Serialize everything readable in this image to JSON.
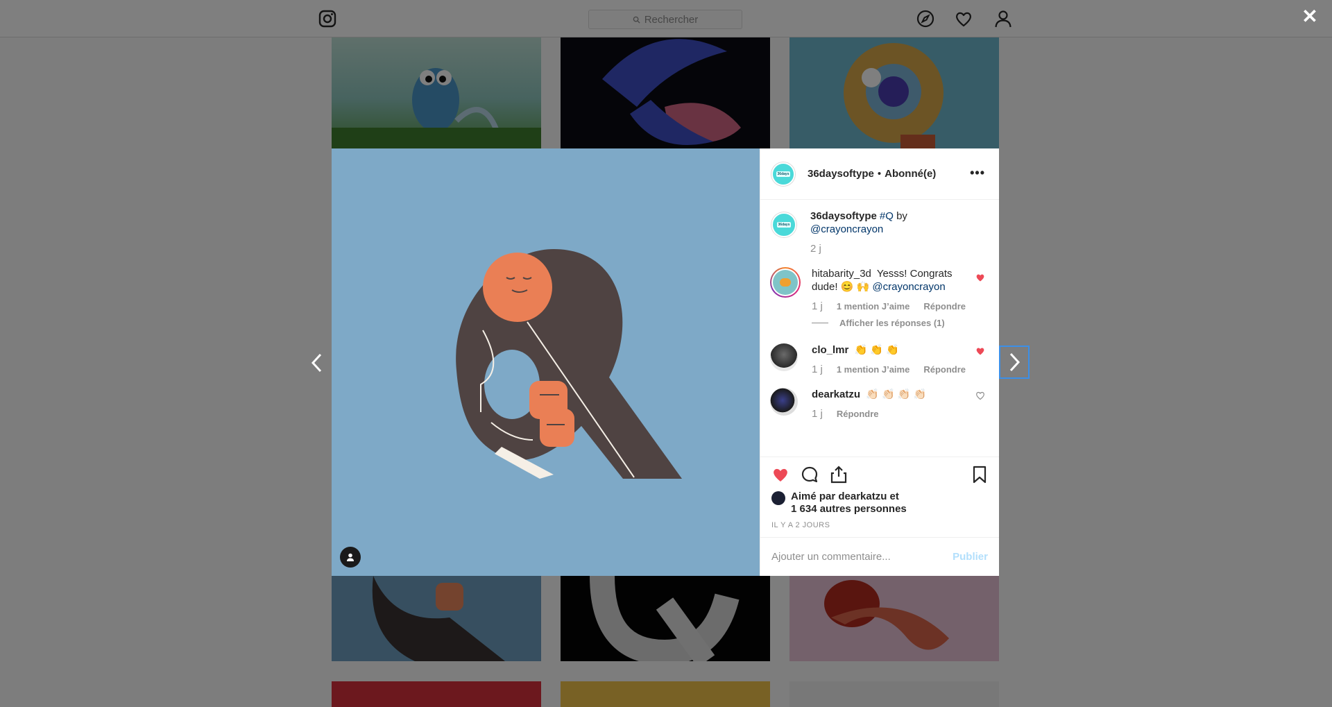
{
  "search": {
    "placeholder": "Rechercher"
  },
  "post": {
    "header": {
      "username": "36daysoftype",
      "separator": "•",
      "follow_status": "Abonné(e)",
      "more": "•••"
    },
    "avatar_badge": "36days",
    "caption": {
      "username": "36daysoftype",
      "hashtag": "#Q",
      "by": "by",
      "mention": "@crayoncrayon",
      "time": "2 j"
    },
    "comments": [
      {
        "username": "hitabarity_3d",
        "text": "Yesss! Congrats dude! 😊 🙌",
        "mention": "@crayoncrayon",
        "time": "1 j",
        "likes": "1 mention J’aime",
        "reply": "Répondre",
        "liked": true
      },
      {
        "username": "clo_lmr",
        "text": "👏 👏 👏",
        "time": "1 j",
        "likes": "1 mention J’aime",
        "reply": "Répondre",
        "liked": true
      },
      {
        "username": "dearkatzu",
        "text": "👏🏻 👏🏻 👏🏻 👏🏻",
        "time": "1 j",
        "reply": "Répondre",
        "liked": false
      }
    ],
    "view_replies": "Afficher les réponses (1)",
    "liked_by": {
      "line1": "Aimé par dearkatzu et",
      "line2": "1 634 autres personnes"
    },
    "posted": "IL Y A 2 JOURS",
    "comment_input": {
      "placeholder": "Ajouter un commentaire...",
      "value": ""
    },
    "publish": "Publier"
  },
  "colors": {
    "like_red": "#ed4956",
    "link_blue": "#003569",
    "publish_disabled": "#b2dffc",
    "focus_blue": "#3b8fe8"
  },
  "icons": [
    "instagram-icon",
    "search-icon",
    "explore-icon",
    "heart-icon",
    "profile-icon",
    "close-icon",
    "chevron-left-icon",
    "chevron-right-icon",
    "more-icon",
    "comment-icon",
    "share-icon",
    "bookmark-icon",
    "user-tag-icon"
  ]
}
